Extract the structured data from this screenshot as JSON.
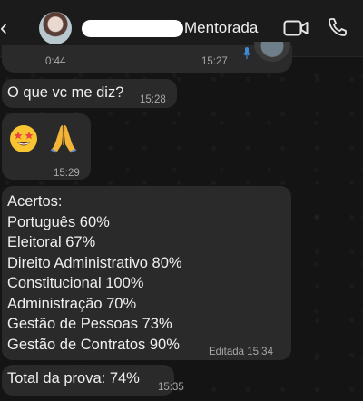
{
  "header": {
    "contact_name": "Mentorada"
  },
  "messages": {
    "audio": {
      "duration": "0:44",
      "time": "15:27"
    },
    "question": {
      "text": "O que vc me diz?",
      "time": "15:28"
    },
    "emoji": {
      "icons": [
        "star-struck-face-icon",
        "folded-hands-icon"
      ],
      "time": "15:29"
    },
    "results": {
      "lines": [
        "Acertos:",
        "Português 60%",
        "Eleitoral 67%",
        "Direito Administrativo 80%",
        "Constitucional 100%",
        "Administração 70%",
        "Gestão de Pessoas 73%",
        "Gestão de Contratos 90%"
      ],
      "edited_time": "Editada 15:34"
    },
    "total": {
      "text": "Total da prova: 74%",
      "time": "15:35"
    }
  },
  "colors": {
    "background": "#141414",
    "header": "#1b1b1b",
    "bubble": "#2a2a2a",
    "text": "#f0f0f0",
    "timestamp": "#a8a8a8",
    "mic_accent": "#3b8bd9"
  }
}
